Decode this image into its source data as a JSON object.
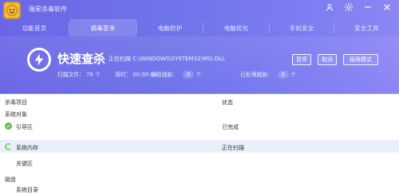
{
  "app": {
    "title": "瑞星杀毒软件"
  },
  "tabs": [
    {
      "label": "功能首页"
    },
    {
      "label": "病毒查杀"
    },
    {
      "label": "电脑防护"
    },
    {
      "label": "电脑优化"
    },
    {
      "label": "手机安全"
    },
    {
      "label": "安全工具"
    }
  ],
  "scan": {
    "title": "快速查杀",
    "status_text": "正在扫描 C:\\WINDOWS\\SYSTEM32\\MSI.DLL",
    "buttons": {
      "pause": "暂停",
      "cancel": "取消",
      "mode": "极限模式"
    },
    "stats": {
      "files_label": "扫描文件：",
      "files_value": "76 个",
      "time_label": "用时：",
      "time_value": "00:00:04",
      "threats_label": "发现威胁：",
      "threats_value": "0",
      "threats_unit": "个",
      "handled_label": "已处理威胁：",
      "handled_value": "0",
      "handled_unit": "个"
    }
  },
  "table": {
    "headers": {
      "item": "杀毒项目",
      "status": "状态"
    },
    "rows": [
      {
        "item": "系统对象",
        "status": ""
      },
      {
        "item": "引导区",
        "status": "已完成"
      },
      {
        "item": "系统内存",
        "status": "正在扫描"
      },
      {
        "item": "关键区",
        "status": ""
      },
      {
        "item": "磁盘",
        "status": ""
      },
      {
        "item": "系统目录",
        "status": ""
      }
    ]
  }
}
